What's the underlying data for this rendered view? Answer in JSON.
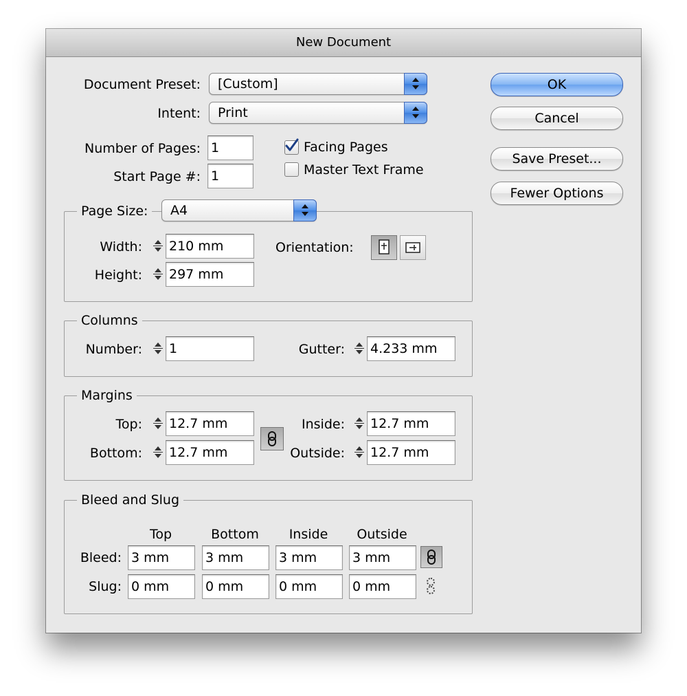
{
  "window": {
    "title": "New Document"
  },
  "top": {
    "preset_label": "Document Preset:",
    "preset_value": "[Custom]",
    "intent_label": "Intent:",
    "intent_value": "Print",
    "pages_label": "Number of Pages:",
    "pages_value": "1",
    "start_label": "Start Page #:",
    "start_value": "1",
    "facing_label": "Facing Pages",
    "facing_checked": true,
    "master_label": "Master Text Frame",
    "master_checked": false
  },
  "buttons": {
    "ok": "OK",
    "cancel": "Cancel",
    "save_preset": "Save Preset...",
    "fewer_options": "Fewer Options"
  },
  "page_size": {
    "label": "Page Size:",
    "value": "A4",
    "width_label": "Width:",
    "width_value": "210 mm",
    "height_label": "Height:",
    "height_value": "297 mm",
    "orientation_label": "Orientation:",
    "orientation_selected": "portrait"
  },
  "columns": {
    "title": "Columns",
    "number_label": "Number:",
    "number_value": "1",
    "gutter_label": "Gutter:",
    "gutter_value": "4.233 mm"
  },
  "margins": {
    "title": "Margins",
    "top_label": "Top:",
    "top_value": "12.7 mm",
    "bottom_label": "Bottom:",
    "bottom_value": "12.7 mm",
    "inside_label": "Inside:",
    "inside_value": "12.7 mm",
    "outside_label": "Outside:",
    "outside_value": "12.7 mm",
    "linked": true
  },
  "bleed_slug": {
    "title": "Bleed and Slug",
    "headers": [
      "Top",
      "Bottom",
      "Inside",
      "Outside"
    ],
    "bleed_label": "Bleed:",
    "bleed_values": [
      "3 mm",
      "3 mm",
      "3 mm",
      "3 mm"
    ],
    "slug_label": "Slug:",
    "slug_values": [
      "0 mm",
      "0 mm",
      "0 mm",
      "0 mm"
    ],
    "bleed_linked": true,
    "slug_linked": false
  }
}
